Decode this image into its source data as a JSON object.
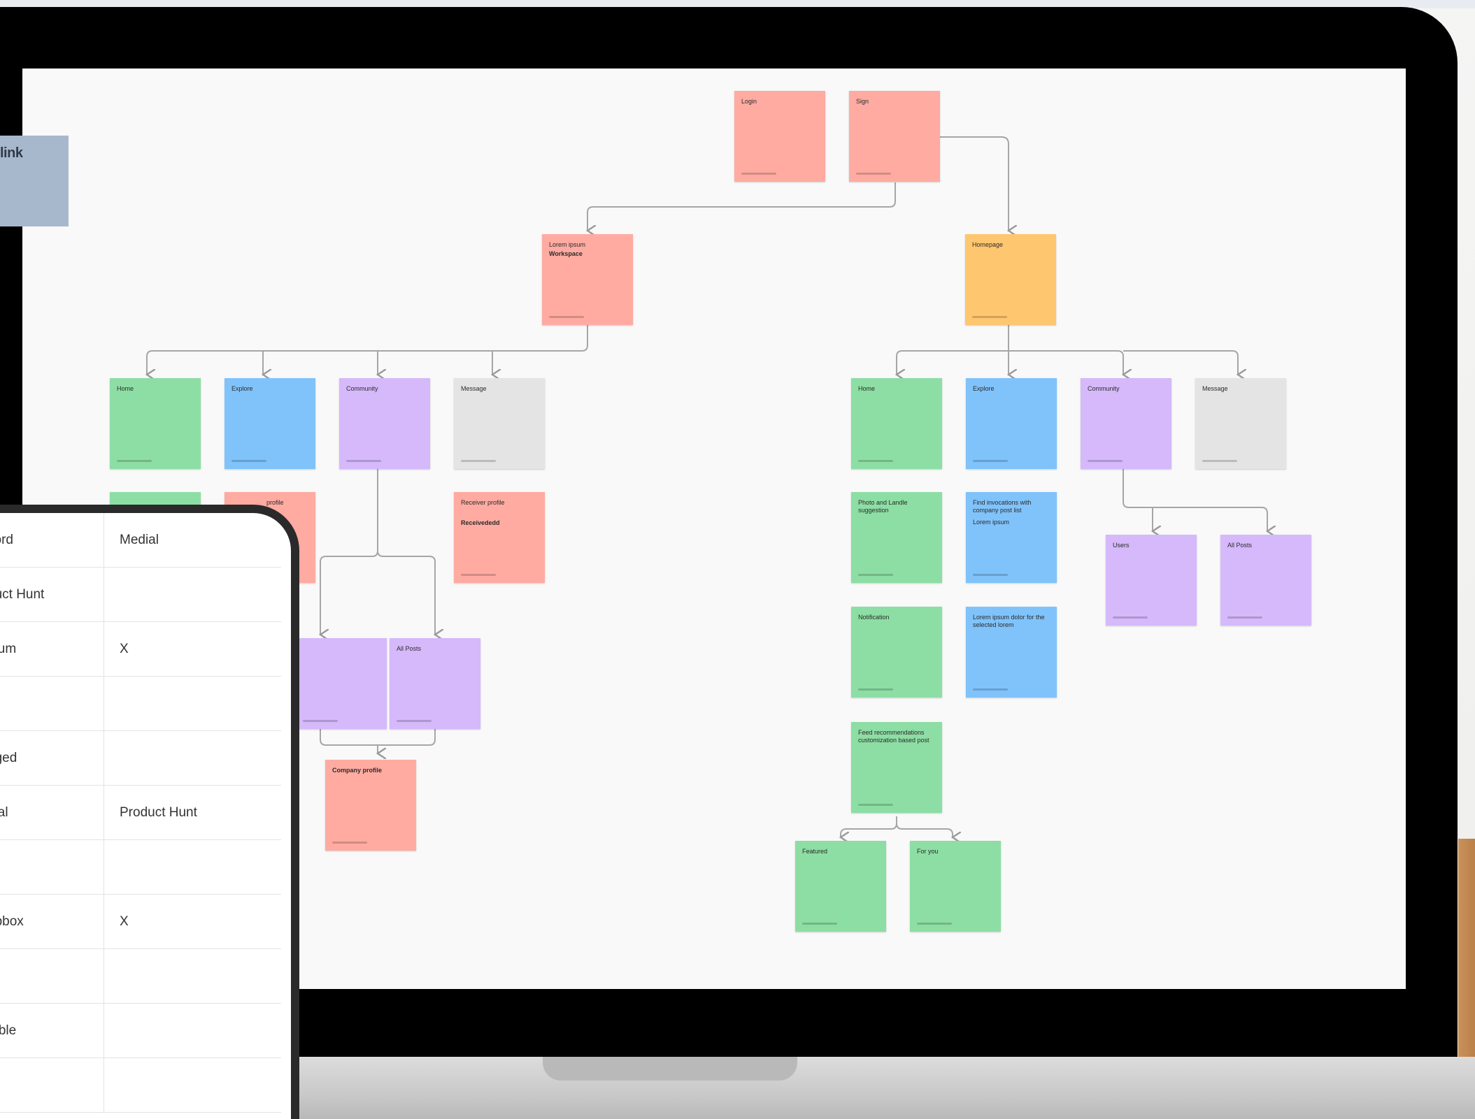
{
  "notes": [
    {
      "id": "n1",
      "color": "red",
      "title": "Login",
      "sub": ""
    },
    {
      "id": "n2",
      "color": "red",
      "title": "Sign",
      "sub": ""
    },
    {
      "id": "n3",
      "color": "red",
      "title": "Lorem ipsum",
      "sub": "Workspace"
    },
    {
      "id": "n4",
      "color": "orange",
      "title": "Homepage",
      "sub": ""
    },
    {
      "id": "n5",
      "color": "green",
      "title": "Home",
      "sub": ""
    },
    {
      "id": "n6",
      "color": "blue",
      "title": "Explore",
      "sub": ""
    },
    {
      "id": "n7",
      "color": "purple",
      "title": "Community",
      "sub": ""
    },
    {
      "id": "n8",
      "color": "gray",
      "title": "Message",
      "sub": ""
    },
    {
      "id": "n9",
      "color": "green",
      "title": "Home",
      "sub": ""
    },
    {
      "id": "n10",
      "color": "blue",
      "title": "Explore",
      "sub": ""
    },
    {
      "id": "n11",
      "color": "purple",
      "title": "Community",
      "sub": ""
    },
    {
      "id": "n12",
      "color": "gray",
      "title": "Message",
      "sub": ""
    },
    {
      "id": "n13",
      "color": "green",
      "title": "",
      "sub": ""
    },
    {
      "id": "n14",
      "color": "red",
      "title": "profile",
      "sub": ""
    },
    {
      "id": "n15",
      "color": "red",
      "title": "Receiver profile",
      "sub": "Receivededd"
    },
    {
      "id": "n16",
      "color": "purple",
      "title": "",
      "sub": ""
    },
    {
      "id": "n17",
      "color": "purple",
      "title": "All Posts",
      "sub": ""
    },
    {
      "id": "n18",
      "color": "red",
      "title": "Company profile",
      "sub": ""
    },
    {
      "id": "n19",
      "color": "green",
      "title": "Photo and Landle suggestion",
      "sub": ""
    },
    {
      "id": "n20",
      "color": "blue",
      "title": "Find invocations with company post list",
      "sub": "Lorem ipsum"
    },
    {
      "id": "n21",
      "color": "purple",
      "title": "Users",
      "sub": ""
    },
    {
      "id": "n22",
      "color": "purple",
      "title": "All Posts",
      "sub": ""
    },
    {
      "id": "n23",
      "color": "green",
      "title": "Notification",
      "sub": ""
    },
    {
      "id": "n24",
      "color": "blue",
      "title": "Lorem ipsum dolor for the selected lorem",
      "sub": ""
    },
    {
      "id": "n25",
      "color": "green",
      "title": "Feed recommendations customization based post",
      "sub": ""
    },
    {
      "id": "n26",
      "color": "green",
      "title": "Featured",
      "sub": ""
    },
    {
      "id": "n27",
      "color": "green",
      "title": "For you",
      "sub": ""
    }
  ],
  "link_card": {
    "label": "link"
  },
  "phone_table": {
    "rows": [
      [
        "cord",
        "Medial"
      ],
      [
        "duct Hunt",
        ""
      ],
      [
        "dium",
        "X"
      ],
      [
        "",
        ""
      ],
      [
        "dged",
        ""
      ],
      [
        "dial",
        "Product Hunt"
      ],
      [
        ")",
        ""
      ],
      [
        "opbox",
        "X"
      ],
      [
        "",
        ""
      ],
      [
        "mble",
        ""
      ],
      [
        "",
        ""
      ]
    ]
  }
}
